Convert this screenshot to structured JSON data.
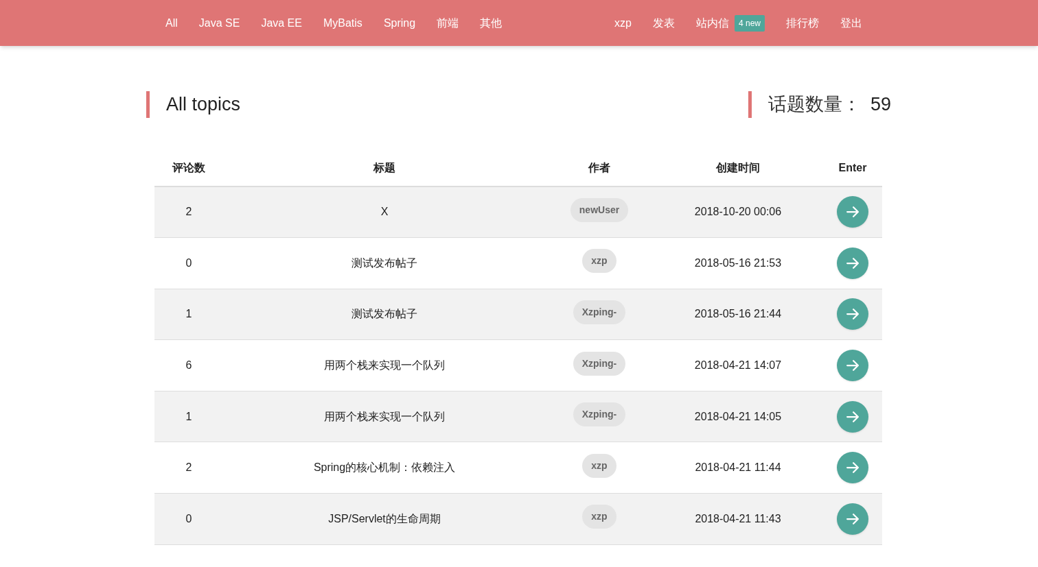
{
  "nav": {
    "left": [
      {
        "label": "All"
      },
      {
        "label": "Java SE"
      },
      {
        "label": "Java EE"
      },
      {
        "label": "MyBatis"
      },
      {
        "label": "Spring"
      },
      {
        "label": "前端"
      },
      {
        "label": "其他"
      }
    ],
    "right": [
      {
        "label": "xzp"
      },
      {
        "label": "发表"
      },
      {
        "label": "站内信",
        "badge": "4 new"
      },
      {
        "label": "排行榜"
      },
      {
        "label": "登出"
      }
    ]
  },
  "heading": {
    "title": "All topics",
    "count_label": "话题数量：",
    "count": "59"
  },
  "table": {
    "columns": [
      "评论数",
      "标题",
      "作者",
      "创建时间",
      "Enter"
    ],
    "rows": [
      {
        "comments": "2",
        "title": "X",
        "author": "newUser",
        "created": "2018-10-20 00:06"
      },
      {
        "comments": "0",
        "title": "测试发布帖子",
        "author": "xzp",
        "created": "2018-05-16 21:53"
      },
      {
        "comments": "1",
        "title": "测试发布帖子",
        "author": "Xzping-",
        "created": "2018-05-16 21:44"
      },
      {
        "comments": "6",
        "title": "用两个栈来实现一个队列",
        "author": "Xzping-",
        "created": "2018-04-21 14:07"
      },
      {
        "comments": "1",
        "title": "用两个栈来实现一个队列",
        "author": "Xzping-",
        "created": "2018-04-21 14:05"
      },
      {
        "comments": "2",
        "title": "Spring的核心机制：依赖注入",
        "author": "xzp",
        "created": "2018-04-21 11:44"
      },
      {
        "comments": "0",
        "title": "JSP/Servlet的生命周期",
        "author": "xzp",
        "created": "2018-04-21 11:43"
      }
    ]
  }
}
